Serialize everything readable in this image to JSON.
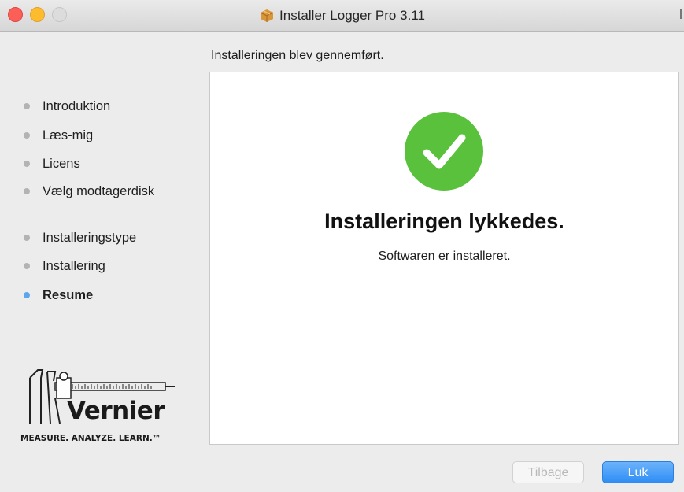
{
  "window": {
    "title": "Installer Logger Pro 3.11",
    "icons": [
      "package-icon",
      "close-traffic-light",
      "minimize-traffic-light",
      "zoom-traffic-light"
    ]
  },
  "header": {
    "text": "Installeringen blev gennemført."
  },
  "sidebar": {
    "steps": [
      {
        "label": "Introduktion",
        "active": false
      },
      {
        "label": "Læs-mig",
        "active": false
      },
      {
        "label": "Licens",
        "active": false
      },
      {
        "label": "Vælg modtagerdisk",
        "active": false
      },
      {
        "label": "Installeringstype",
        "active": false
      },
      {
        "label": "Installering",
        "active": false
      },
      {
        "label": "Resume",
        "active": true
      }
    ],
    "logo": {
      "name": "Vernier",
      "tagline": "MEASURE. ANALYZE. LEARN.™"
    }
  },
  "main": {
    "status_icon": "checkmark-circle-icon",
    "title": "Installeringen lykkedes.",
    "subtitle": "Softwaren er installeret."
  },
  "buttons": {
    "back_label": "Tilbage",
    "close_label": "Luk"
  },
  "colors": {
    "success_green": "#5ac13d",
    "active_dot": "#5aa7ef",
    "primary_button": "#2e8ef5"
  }
}
